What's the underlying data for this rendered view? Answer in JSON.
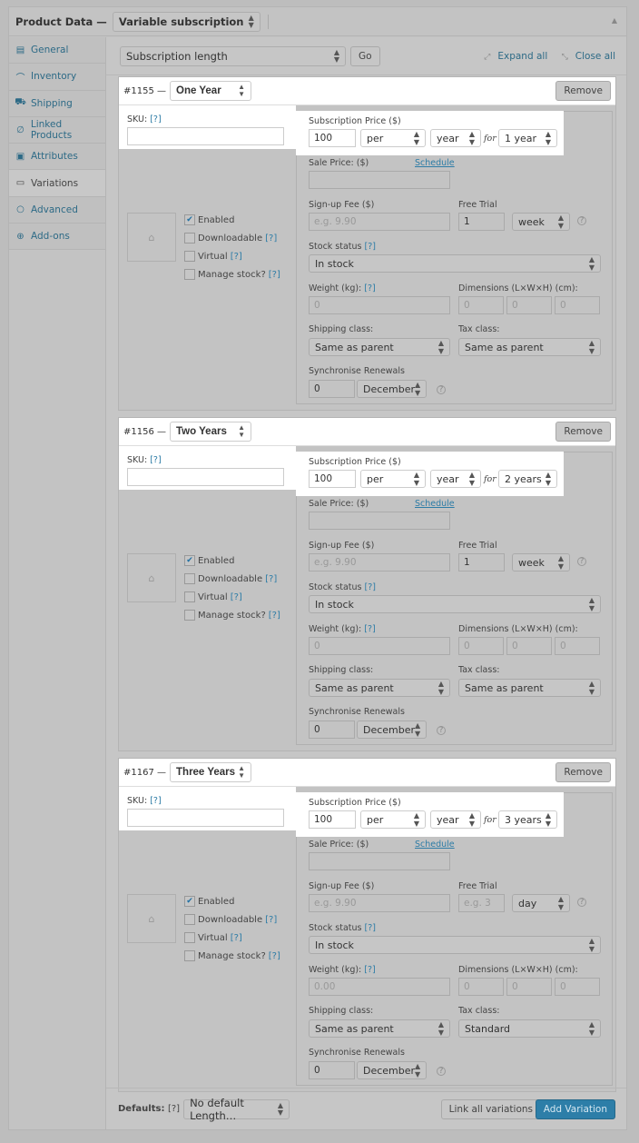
{
  "header": {
    "title": "Product Data —",
    "product_type": "Variable subscription"
  },
  "sidebar": {
    "items": [
      {
        "label": "General",
        "icon": "general-icon",
        "glyph": "▤",
        "active": false
      },
      {
        "label": "Inventory",
        "icon": "inventory-icon",
        "glyph": "⌒",
        "active": false
      },
      {
        "label": "Shipping",
        "icon": "truck-icon",
        "glyph": "⛟",
        "active": false
      },
      {
        "label": "Linked Products",
        "icon": "link-icon",
        "glyph": "∅",
        "active": false
      },
      {
        "label": "Attributes",
        "icon": "attributes-icon",
        "glyph": "▣",
        "active": false
      },
      {
        "label": "Variations",
        "icon": "variations-icon",
        "glyph": "▭",
        "active": true
      },
      {
        "label": "Advanced",
        "icon": "gear-icon",
        "glyph": "○",
        "active": false
      },
      {
        "label": "Add-ons",
        "icon": "plus-circle-icon",
        "glyph": "⊕",
        "active": false
      }
    ]
  },
  "toolbar": {
    "bulk_action": "Subscription length",
    "go_label": "Go",
    "expand_all": "Expand all",
    "close_all": "Close all"
  },
  "labels": {
    "sku": "SKU:",
    "help": "[?]",
    "subscription_price": "Subscription Price ($)",
    "for": "for",
    "sale_price": "Sale Price: ($)",
    "schedule": "Schedule",
    "signup_fee": "Sign-up Fee ($)",
    "free_trial": "Free Trial",
    "stock_status": "Stock status",
    "weight": "Weight (kg):",
    "dimensions": "Dimensions (L×W×H) (cm):",
    "shipping_class": "Shipping class:",
    "tax_class": "Tax class:",
    "sync_renewals": "Synchronise Renewals",
    "enabled": "Enabled",
    "downloadable": "Downloadable",
    "virtual": "Virtual",
    "manage_stock": "Manage stock?",
    "remove": "Remove"
  },
  "variations": [
    {
      "id": "#1155 —",
      "length": "One Year",
      "sku": "",
      "price": "100",
      "per": "per",
      "period": "year",
      "duration": "1 year",
      "sale_price": "",
      "signup_fee_placeholder": "e.g. 9.90",
      "trial_length": "1",
      "trial_length_placeholder": "",
      "trial_period": "week",
      "stock_status": "In stock",
      "weight_placeholder": "0",
      "dims": [
        "0",
        "0",
        "0"
      ],
      "shipping_class": "Same as parent",
      "tax_class": "Same as parent",
      "sync_day": "0",
      "sync_month": "December",
      "enabled": true,
      "downloadable": false,
      "virtual": false,
      "manage_stock": false
    },
    {
      "id": "#1156 —",
      "length": "Two Years",
      "sku": "",
      "price": "100",
      "per": "per",
      "period": "year",
      "duration": "2 years",
      "sale_price": "",
      "signup_fee_placeholder": "e.g. 9.90",
      "trial_length": "1",
      "trial_length_placeholder": "",
      "trial_period": "week",
      "stock_status": "In stock",
      "weight_placeholder": "0",
      "dims": [
        "0",
        "0",
        "0"
      ],
      "shipping_class": "Same as parent",
      "tax_class": "Same as parent",
      "sync_day": "0",
      "sync_month": "December",
      "enabled": true,
      "downloadable": false,
      "virtual": false,
      "manage_stock": false
    },
    {
      "id": "#1167 —",
      "length": "Three Years",
      "sku": "",
      "price": "100",
      "per": "per",
      "period": "year",
      "duration": "3 years",
      "sale_price": "",
      "signup_fee_placeholder": "e.g. 9.90",
      "trial_length": "",
      "trial_length_placeholder": "e.g. 3",
      "trial_period": "day",
      "stock_status": "In stock",
      "weight_placeholder": "0.00",
      "dims": [
        "0",
        "0",
        "0"
      ],
      "shipping_class": "Same as parent",
      "tax_class": "Standard",
      "sync_day": "0",
      "sync_month": "December",
      "enabled": true,
      "downloadable": false,
      "virtual": false,
      "manage_stock": false
    }
  ],
  "footer": {
    "defaults_label": "Defaults:",
    "defaults_help": "[?]",
    "default_length": "No default Length…",
    "link_all": "Link all variations",
    "add_variation": "Add Variation"
  }
}
